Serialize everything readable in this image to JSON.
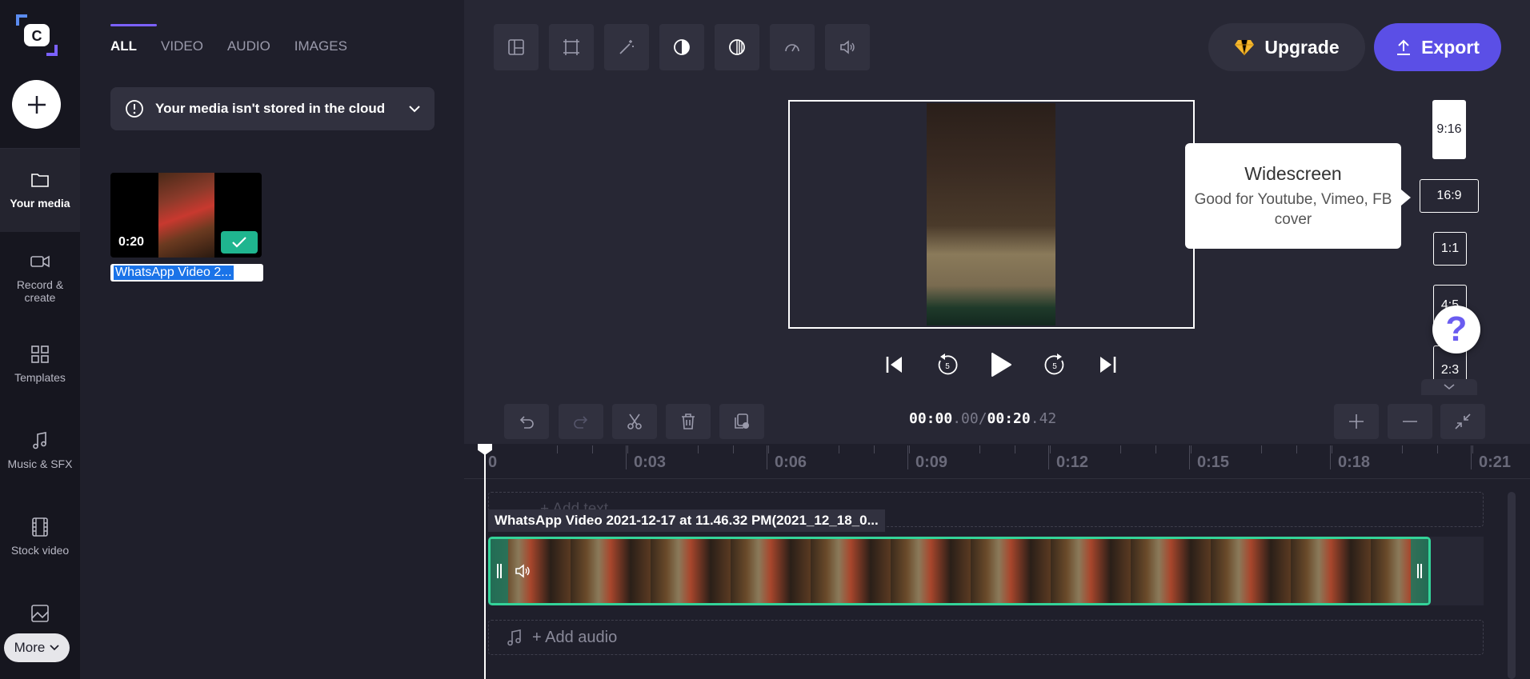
{
  "sidebar": {
    "items": [
      {
        "label": "Your media",
        "icon": "folder-icon"
      },
      {
        "label": "Record & create",
        "icon": "camera-icon"
      },
      {
        "label": "Templates",
        "icon": "templates-icon"
      },
      {
        "label": "Music & SFX",
        "icon": "music-note-icon"
      },
      {
        "label": "Stock video",
        "icon": "film-icon"
      },
      {
        "label": "",
        "icon": "image-icon"
      }
    ],
    "more_label": "More"
  },
  "media": {
    "tabs": [
      "ALL",
      "VIDEO",
      "AUDIO",
      "IMAGES"
    ],
    "active_tab": "ALL",
    "cloud_notice": "Your media isn't stored in the cloud",
    "item": {
      "duration": "0:20",
      "name": "WhatsApp Video 2..."
    }
  },
  "header": {
    "upgrade_label": "Upgrade",
    "export_label": "Export"
  },
  "aspect_ratios": [
    "9:16",
    "16:9",
    "1:1",
    "4:5",
    "2:3"
  ],
  "tooltip": {
    "title": "Widescreen",
    "description": "Good for Youtube, Vimeo, FB cover"
  },
  "help_label": "?",
  "timeline": {
    "current_time_main": "00:00",
    "current_time_frac": ".00",
    "separator": "/",
    "total_time_main": "00:20",
    "total_time_frac": ".42",
    "ruler_ticks": [
      "0",
      "0:03",
      "0:06",
      "0:09",
      "0:12",
      "0:15",
      "0:18",
      "0:21"
    ],
    "text_track_label": "+ Add text",
    "clip_title": "WhatsApp Video 2021-12-17 at 11.46.32 PM(2021_12_18_0...",
    "audio_track_label": "+ Add audio"
  },
  "colors": {
    "accent": "#5b4fe6",
    "clip_border": "#34d399",
    "check_badge": "#1fb58f"
  }
}
